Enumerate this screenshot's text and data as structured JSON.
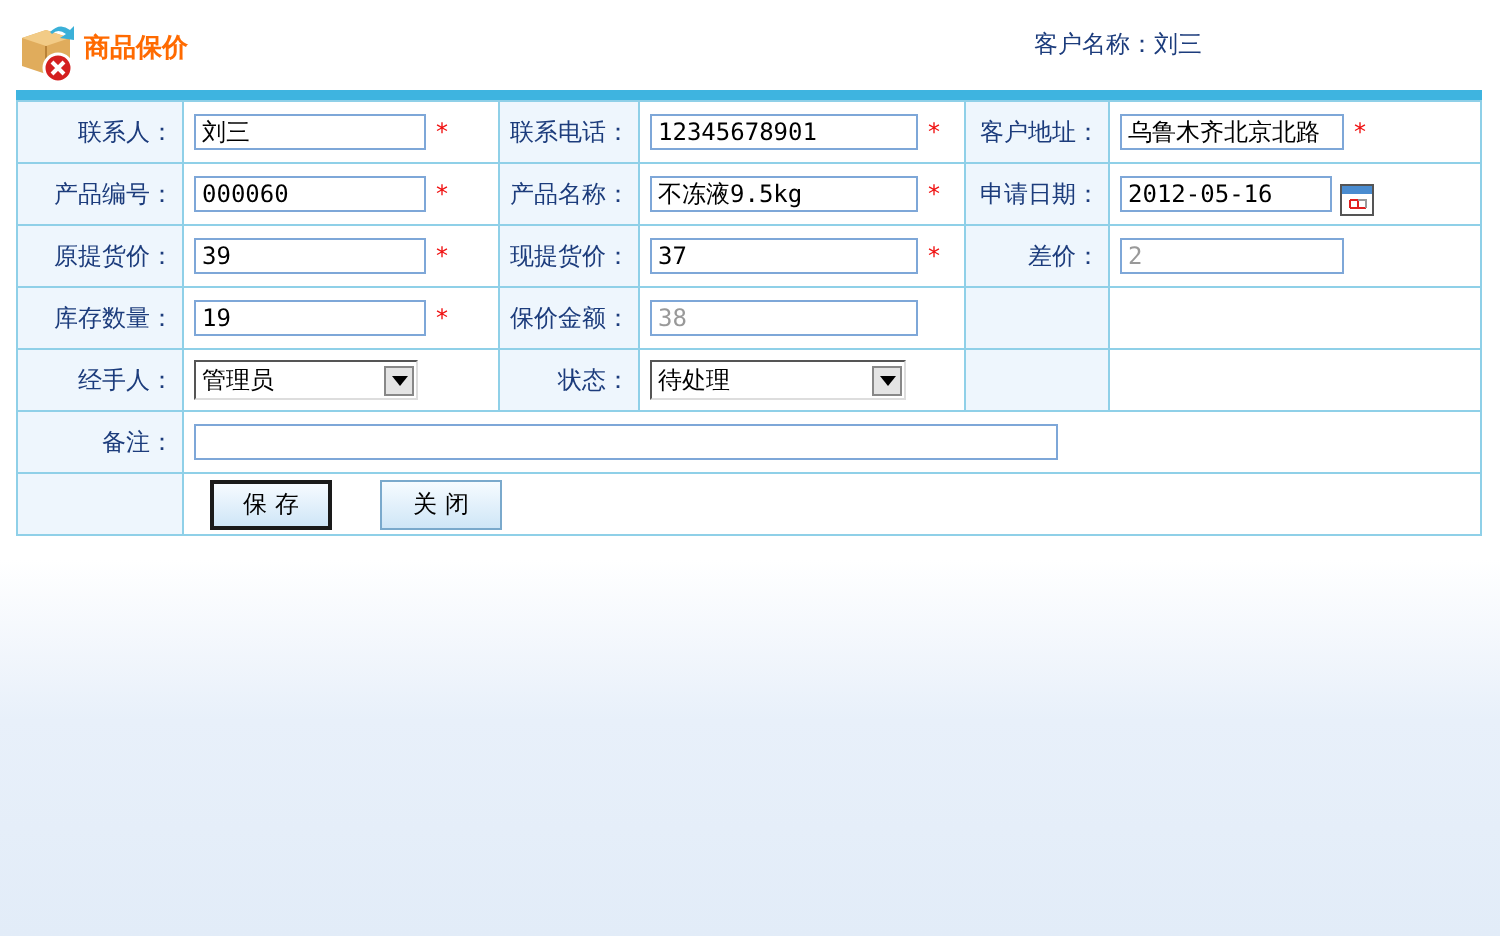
{
  "header": {
    "title": "商品保价",
    "customer_label": "客户名称：",
    "customer_name": "刘三"
  },
  "rows": [
    {
      "cells": [
        {
          "label": "联系人：",
          "kind": "text",
          "value": "刘三",
          "mark": "*",
          "disabled": false
        },
        {
          "label": "联系电话：",
          "kind": "text",
          "value": "12345678901",
          "mark": "*",
          "disabled": false
        },
        {
          "label": "客户地址：",
          "kind": "text",
          "value": "乌鲁木齐北京北路",
          "mark": "*",
          "disabled": false
        }
      ]
    },
    {
      "cells": [
        {
          "label": "产品编号：",
          "kind": "text",
          "value": "000060",
          "mark": "*",
          "disabled": false
        },
        {
          "label": "产品名称：",
          "kind": "text",
          "value": "不冻液9.5kg",
          "mark": "*",
          "disabled": false
        },
        {
          "label": "申请日期：",
          "kind": "date",
          "value": "2012-05-16",
          "disabled": false
        }
      ]
    },
    {
      "cells": [
        {
          "label": "原提货价：",
          "kind": "text",
          "value": "39",
          "mark": "*",
          "disabled": false
        },
        {
          "label": "现提货价：",
          "kind": "text",
          "value": "37",
          "mark": "*",
          "disabled": false
        },
        {
          "label": "差价：",
          "kind": "text",
          "value": "2",
          "disabled": true
        }
      ]
    },
    {
      "cells": [
        {
          "label": "库存数量：",
          "kind": "text",
          "value": "19",
          "mark": "*",
          "disabled": false
        },
        {
          "label": "保价金额：",
          "kind": "text",
          "value": "38",
          "disabled": true
        },
        {
          "kind": "empty"
        }
      ]
    },
    {
      "cells": [
        {
          "label": "经手人：",
          "kind": "select",
          "value": "管理员",
          "disabled": false
        },
        {
          "label": "状态：",
          "kind": "select",
          "value": "待处理",
          "disabled": false
        },
        {
          "kind": "empty"
        }
      ]
    }
  ],
  "note": {
    "label": "备注："
  },
  "buttons": [
    {
      "label": "保 存",
      "focused": true
    },
    {
      "label": "关 闭",
      "focused": false
    }
  ]
}
